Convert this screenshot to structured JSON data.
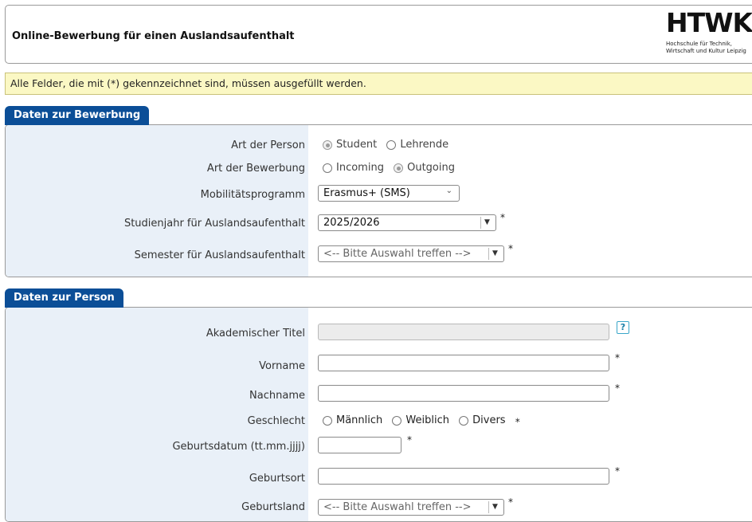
{
  "header": {
    "title": "Online-Bewerbung für einen Auslandsaufenthalt",
    "logo_word": "HTWK",
    "logo_sub_1": "Hochschule für Technik,",
    "logo_sub_2": "Wirtschaft und Kultur Leipzig"
  },
  "notice": "Alle Felder, die mit (*) gekennzeichnet sind, müssen ausgefüllt werden.",
  "bewerbung": {
    "tab": "Daten zur Bewerbung",
    "art_person_label": "Art der Person",
    "art_person_options": [
      "Student",
      "Lehrende"
    ],
    "art_bewerbung_label": "Art der Bewerbung",
    "art_bewerbung_options": [
      "Incoming",
      "Outgoing"
    ],
    "mobilitaet_label": "Mobilitätsprogramm",
    "mobilitaet_value": "Erasmus+ (SMS)",
    "studienjahr_label": "Studienjahr für Auslandsaufenthalt",
    "studienjahr_value": "2025/2026",
    "semester_label": "Semester für Auslandsaufenthalt",
    "semester_value": "<-- Bitte Auswahl treffen -->",
    "required_mark": "*"
  },
  "person": {
    "tab": "Daten zur Person",
    "titel_label": "Akademischer Titel",
    "help_icon": "?",
    "vorname_label": "Vorname",
    "nachname_label": "Nachname",
    "geschlecht_label": "Geschlecht",
    "geschlecht_options": [
      "Männlich",
      "Weiblich",
      "Divers"
    ],
    "geburtsdatum_label": "Geburtsdatum (tt.mm.jjjj)",
    "geburtsort_label": "Geburtsort",
    "geburtsland_label": "Geburtsland",
    "geburtsland_value": "<-- Bitte Auswahl treffen -->",
    "required_mark": "*"
  }
}
